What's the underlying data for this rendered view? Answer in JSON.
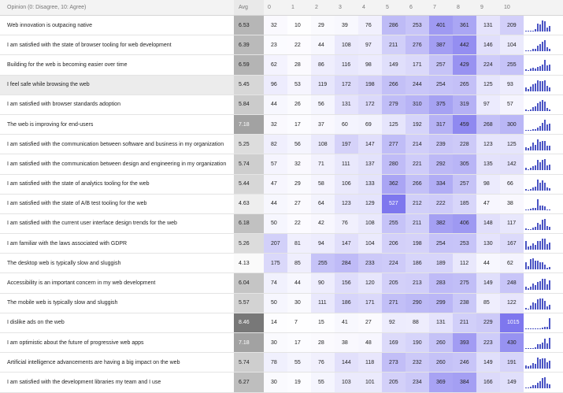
{
  "header": {
    "question": "Opinion (0: Disagree, 10: Agree)",
    "avg": "Avg",
    "scale": [
      "0",
      "1",
      "2",
      "3",
      "4",
      "5",
      "6",
      "7",
      "8",
      "9",
      "10"
    ]
  },
  "colors": {
    "bar": "#4a54c4",
    "accent_cell": "#7e77ee",
    "highlight_row": "#ececec"
  },
  "chart_data": {
    "type": "heatmap",
    "title": "Opinion (0: Disagree, 10: Agree)",
    "columns": [
      "Avg",
      "0",
      "1",
      "2",
      "3",
      "4",
      "5",
      "6",
      "7",
      "8",
      "9",
      "10"
    ],
    "rows": [
      {
        "label": "Web innovation is outpacing native",
        "avg": "6.53",
        "counts": [
          32,
          10,
          29,
          39,
          76,
          286,
          253,
          401,
          361,
          131,
          209
        ]
      },
      {
        "label": "I am satisfied with the state of browser tooling for web development",
        "avg": "6.39",
        "counts": [
          23,
          22,
          44,
          108,
          97,
          211,
          276,
          387,
          442,
          146,
          104
        ]
      },
      {
        "label": "Building for the web is becoming easier over time",
        "avg": "6.59",
        "counts": [
          62,
          28,
          86,
          116,
          98,
          149,
          171,
          257,
          429,
          224,
          255
        ]
      },
      {
        "label": "I feel safe while browsing the web",
        "avg": "5.45",
        "counts": [
          96,
          53,
          119,
          172,
          198,
          266,
          244,
          254,
          265,
          125,
          93
        ]
      },
      {
        "label": "I am satisfied with browser standards adoption",
        "avg": "5.84",
        "counts": [
          44,
          26,
          56,
          131,
          172,
          279,
          310,
          375,
          319,
          97,
          57
        ]
      },
      {
        "label": "The web is improving for end-users",
        "avg": "7.18",
        "counts": [
          32,
          17,
          37,
          60,
          69,
          125,
          192,
          317,
          459,
          268,
          300
        ]
      },
      {
        "label": "I am satisfied with the communication between software and business in my organization",
        "avg": "5.25",
        "counts": [
          82,
          56,
          108,
          197,
          147,
          277,
          214,
          239,
          228,
          123,
          125
        ]
      },
      {
        "label": "I am satisfied with the communication between design and engineering in my organization",
        "avg": "5.74",
        "counts": [
          57,
          32,
          71,
          111,
          137,
          280,
          221,
          292,
          305,
          135,
          142
        ]
      },
      {
        "label": "I am satisfied with the state of analytics tooling for the web",
        "avg": "5.44",
        "counts": [
          47,
          29,
          58,
          106,
          133,
          362,
          266,
          334,
          257,
          98,
          66
        ]
      },
      {
        "label": "I am satisfied with the state of A/B test tooling for the web",
        "avg": "4.63",
        "counts": [
          44,
          27,
          64,
          123,
          129,
          527,
          212,
          222,
          185,
          47,
          38
        ]
      },
      {
        "label": "I am satisfied with the current user interface design trends for the web",
        "avg": "6.18",
        "counts": [
          50,
          22,
          42,
          76,
          108,
          255,
          211,
          382,
          406,
          148,
          117
        ]
      },
      {
        "label": "I am familiar with the laws associated with GDPR",
        "avg": "5.26",
        "counts": [
          207,
          81,
          94,
          147,
          104,
          206,
          198,
          254,
          253,
          130,
          167
        ]
      },
      {
        "label": "The desktop web is typically slow and sluggish",
        "avg": "4.13",
        "counts": [
          175,
          85,
          255,
          284,
          233,
          224,
          186,
          189,
          112,
          44,
          62
        ]
      },
      {
        "label": "Accessibility is an important concern in my web development",
        "avg": "6.04",
        "counts": [
          74,
          44,
          90,
          156,
          120,
          205,
          213,
          283,
          275,
          149,
          248
        ]
      },
      {
        "label": "The mobile web is typically slow and sluggish",
        "avg": "5.57",
        "counts": [
          50,
          30,
          111,
          186,
          171,
          271,
          290,
          299,
          238,
          85,
          122
        ]
      },
      {
        "label": "I dislike ads on the web",
        "avg": "8.46",
        "counts": [
          14,
          7,
          15,
          41,
          27,
          92,
          88,
          131,
          211,
          229,
          1015
        ]
      },
      {
        "label": "I am optimistic about the future of progressive web apps",
        "avg": "7.18",
        "counts": [
          30,
          17,
          28,
          38,
          48,
          169,
          190,
          260,
          393,
          223,
          430
        ]
      },
      {
        "label": "Artificial intelligence advancements are having a big impact on the web",
        "avg": "5.74",
        "counts": [
          78,
          55,
          76,
          144,
          118,
          273,
          232,
          260,
          246,
          149,
          191
        ]
      },
      {
        "label": "I am satisfied with the development libraries my team and I use",
        "avg": "6.27",
        "counts": [
          30,
          19,
          55,
          103,
          101,
          205,
          234,
          369,
          384,
          166,
          149
        ]
      }
    ],
    "highlighted_row": 3,
    "grid": true
  }
}
